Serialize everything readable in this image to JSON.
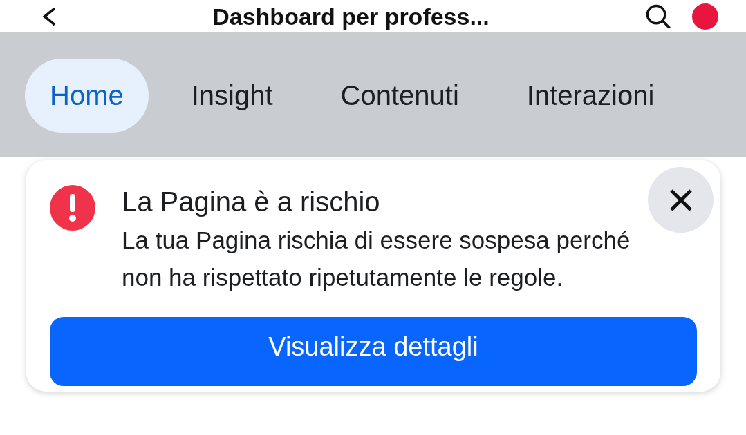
{
  "header": {
    "title": "Dashboard per profess..."
  },
  "tabs": [
    {
      "label": "Home",
      "selected": true
    },
    {
      "label": "Insight",
      "selected": false
    },
    {
      "label": "Contenuti",
      "selected": false
    },
    {
      "label": "Interazioni",
      "selected": false
    }
  ],
  "alert": {
    "title": "La Pagina è a rischio",
    "message": "La tua Pagina rischia di essere sospesa perché non ha rispettato ripetutamente le regole.",
    "button": "Visualizza dettagli"
  }
}
